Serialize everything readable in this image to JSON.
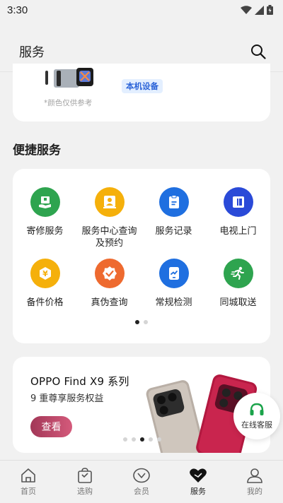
{
  "status_bar": {
    "time": "3:30"
  },
  "header": {
    "title": "服务",
    "search_icon": "search-icon"
  },
  "device_card": {
    "tag": "本机设备",
    "note": "*颜色仅供参考"
  },
  "quick_services": {
    "title": "便捷服务",
    "items": [
      {
        "label": "寄修服务",
        "icon": "box-hand-icon",
        "color": "#2ea44f"
      },
      {
        "label": "服务中心查询\n及预约",
        "icon": "person-center-icon",
        "color": "#f5b00b"
      },
      {
        "label": "服务记录",
        "icon": "clipboard-icon",
        "color": "#1f6fe0"
      },
      {
        "label": "电视上门",
        "icon": "tv-icon",
        "color": "#2a4ad8"
      },
      {
        "label": "备件价格",
        "icon": "yen-icon",
        "color": "#f5b00b"
      },
      {
        "label": "真伪查询",
        "icon": "verified-badge-icon",
        "color": "#ee6a2f"
      },
      {
        "label": "常规检测",
        "icon": "diagnostic-icon",
        "color": "#1f6fe0"
      },
      {
        "label": "同城取送",
        "icon": "runner-icon",
        "color": "#2ea44f"
      }
    ],
    "pager": {
      "count": 2,
      "active": 0
    }
  },
  "promo": {
    "title": "OPPO Find X9 系列",
    "subtitle": "9 重尊享服务权益",
    "button_label": "查看",
    "pager": {
      "count": 5,
      "active": 2
    }
  },
  "chat_fab": {
    "label": "在线客服",
    "icon": "headset-icon",
    "color": "#1aa34a"
  },
  "bottom_nav": {
    "items": [
      {
        "label": "首页",
        "icon": "home-icon"
      },
      {
        "label": "选购",
        "icon": "shopping-bag-icon"
      },
      {
        "label": "会员",
        "icon": "member-icon"
      },
      {
        "label": "服务",
        "icon": "heart-icon",
        "active": true
      },
      {
        "label": "我的",
        "icon": "profile-icon"
      }
    ]
  }
}
